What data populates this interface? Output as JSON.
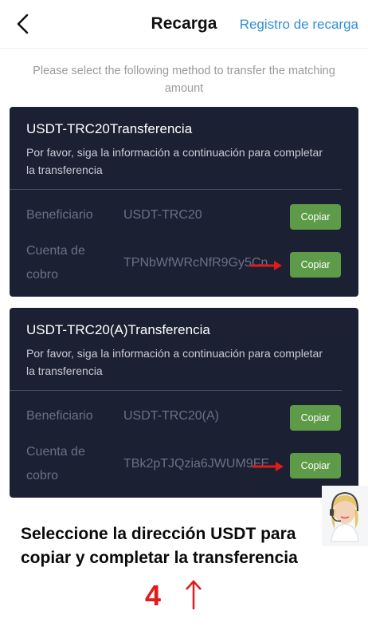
{
  "header": {
    "title": "Recarga",
    "link": "Registro de recarga"
  },
  "instruction": "Please select the following method to transfer the matching amount",
  "cards": [
    {
      "title": "USDT-TRC20Transferencia",
      "description": "Por favor, siga la información a continuación para completar la transferencia",
      "beneficiary_label": "Beneficiario",
      "beneficiary_value": "USDT-TRC20",
      "account_label": "Cuenta de cobro",
      "account_value": "TPNbWfWRcNfR9Gy5Cn",
      "copy_label": "Copiar"
    },
    {
      "title": "USDT-TRC20(A)Transferencia",
      "description": "Por favor, siga la información a continuación para completar la transferencia",
      "beneficiary_label": "Beneficiario",
      "beneficiary_value": "USDT-TRC20(A)",
      "account_label": "Cuenta de cobro",
      "account_value": "TBk2pTJQzia6JWUM9FE",
      "copy_label": "Copiar"
    }
  ],
  "footer": {
    "text": "Seleccione la dirección USDT para copiar y completar la transferencia",
    "step": "4"
  },
  "colors": {
    "card_bg": "#1c2033",
    "copy_button": "#5e9b48",
    "link": "#2e8fd6",
    "annotation_red": "#e11b1b"
  }
}
